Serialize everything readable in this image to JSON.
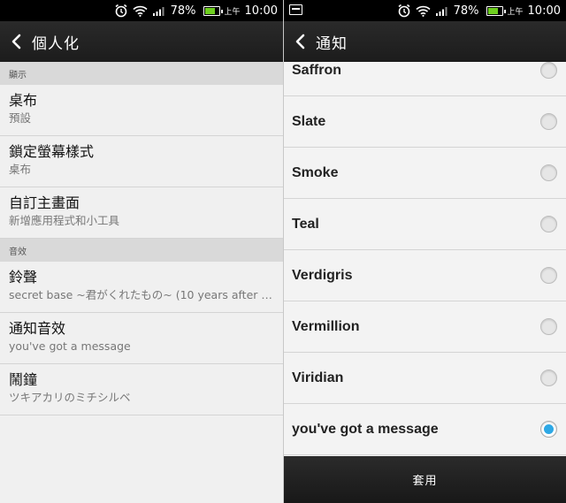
{
  "status_bar": {
    "battery_percent": "78%",
    "battery_level": 0.78,
    "am_pm": "上午",
    "time": "10:00"
  },
  "left_screen": {
    "title": "個人化",
    "sections": [
      {
        "header": "顯示",
        "items": [
          {
            "title": "桌布",
            "summary": "預設"
          },
          {
            "title": "鎖定螢幕樣式",
            "summary": "桌布"
          },
          {
            "title": "自訂主畫面",
            "summary": "新增應用程式和小工具"
          }
        ]
      },
      {
        "header": "音效",
        "items": [
          {
            "title": "鈴聲",
            "summary": "secret base ~君がくれたもの~ (10 years after V..."
          },
          {
            "title": "通知音效",
            "summary": "you've got a message"
          },
          {
            "title": "鬧鐘",
            "summary": "ツキアカリのミチシルベ"
          }
        ]
      }
    ]
  },
  "right_screen": {
    "title": "通知",
    "options": [
      {
        "label": "Saffron",
        "selected": false
      },
      {
        "label": "Slate",
        "selected": false
      },
      {
        "label": "Smoke",
        "selected": false
      },
      {
        "label": "Teal",
        "selected": false
      },
      {
        "label": "Verdigris",
        "selected": false
      },
      {
        "label": "Vermillion",
        "selected": false
      },
      {
        "label": "Viridian",
        "selected": false
      },
      {
        "label": "you've got a message",
        "selected": true
      }
    ],
    "apply_label": "套用"
  },
  "colors": {
    "accent_radio": "#2ea8e5",
    "battery_fill": "#6ecf1f"
  }
}
